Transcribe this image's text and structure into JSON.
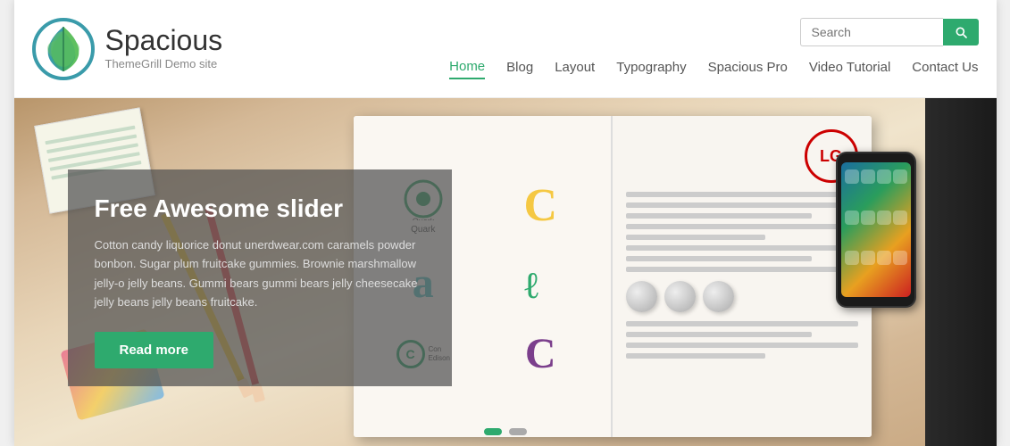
{
  "site": {
    "name": "Spacious",
    "tagline": "ThemeGrill Demo site"
  },
  "search": {
    "placeholder": "Search",
    "button_label": "Search"
  },
  "nav": {
    "items": [
      {
        "label": "Home",
        "active": true
      },
      {
        "label": "Blog",
        "active": false
      },
      {
        "label": "Layout",
        "active": false
      },
      {
        "label": "Typography",
        "active": false
      },
      {
        "label": "Spacious Pro",
        "active": false
      },
      {
        "label": "Video Tutorial",
        "active": false
      },
      {
        "label": "Contact Us",
        "active": false
      }
    ]
  },
  "hero": {
    "title": "Free Awesome slider",
    "body": "Cotton candy liquorice donut unerdwear.com caramels powder bonbon. Sugar plum fruitcake gummies. Brownie marshmallow jelly-o jelly beans. Gummi bears gummi bears jelly cheesecake jelly beans jelly beans fruitcake.",
    "read_more_label": "Read more",
    "dots": [
      {
        "active": true
      },
      {
        "active": false
      }
    ]
  },
  "colors": {
    "accent": "#2eaa6e",
    "overlay_bg": "rgba(80,80,80,0.72)"
  }
}
